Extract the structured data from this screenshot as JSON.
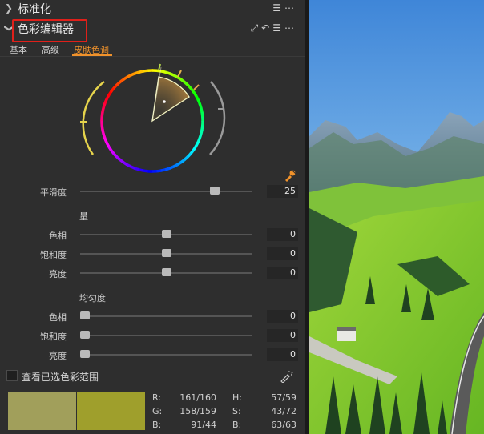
{
  "panels": {
    "collapsed": {
      "title": "标准化"
    },
    "editor": {
      "title": "色彩编辑器"
    }
  },
  "tabs": [
    {
      "label": "基本",
      "active": false
    },
    {
      "label": "高级",
      "active": false
    },
    {
      "label": "皮肤色调",
      "active": true
    }
  ],
  "smoothness": {
    "label": "平滑度",
    "value": "25",
    "level": 0.8
  },
  "amount": {
    "title": "量",
    "rows": [
      {
        "label": "色相",
        "value": "0",
        "level": 0.5
      },
      {
        "label": "饱和度",
        "value": "0",
        "level": 0.5
      },
      {
        "label": "亮度",
        "value": "0",
        "level": 0.5
      }
    ]
  },
  "uniformity": {
    "title": "均匀度",
    "rows": [
      {
        "label": "色相",
        "value": "0",
        "level": 0.0
      },
      {
        "label": "饱和度",
        "value": "0",
        "level": 0.0
      },
      {
        "label": "亮度",
        "value": "0",
        "level": 0.0
      }
    ]
  },
  "view_selected": {
    "label": "查看已选色彩范围",
    "checked": false
  },
  "swatches": [
    "#a19f5b",
    "#9f9f2c"
  ],
  "color_info": {
    "R": "161/160",
    "G": "158/159",
    "B": "91/44",
    "H": "57/59",
    "S": "43/72",
    "Bv": "63/63"
  },
  "colors": {
    "accent": "#f0922b",
    "highlight": "#e0201a"
  }
}
